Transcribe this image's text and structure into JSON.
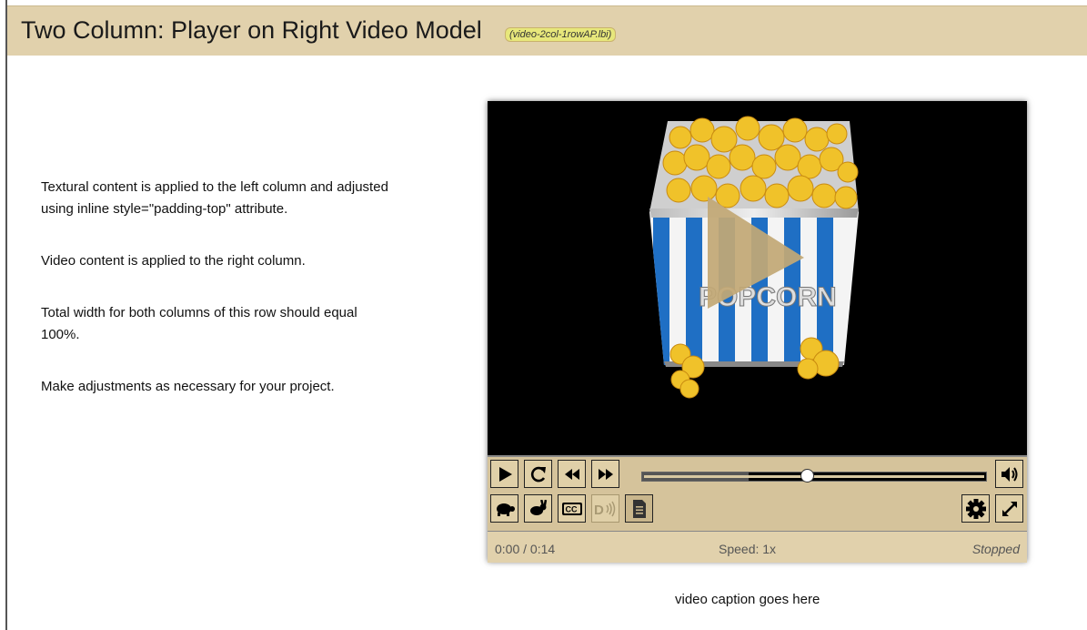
{
  "header": {
    "title": "Two Column: Player on Right Video Model",
    "filename": "(video-2col-1rowAP.lbi)"
  },
  "left_column": {
    "paragraphs": [
      "Textural content is applied to the left column and adjusted using inline style=\"padding-top\" attribute.",
      "Video content is applied to the right column.",
      "Total width for both columns of this row should equal 100%.",
      "Make adjustments as necessary for your project."
    ]
  },
  "player": {
    "poster_text": "POPCORN",
    "progress_fraction": 0.48,
    "buffered_fraction": 0.31,
    "time": "0:00 / 0:14",
    "speed": "Speed: 1x",
    "state": "Stopped",
    "buttons": {
      "row1": [
        "play-icon",
        "restart-icon",
        "rewind-icon",
        "fast-forward-icon"
      ],
      "row2": [
        "slower-turtle-icon",
        "faster-rabbit-icon",
        "captions-cc-icon",
        "audio-description-icon",
        "transcript-icon"
      ],
      "right": [
        "volume-icon",
        "settings-gear-icon",
        "fullscreen-icon"
      ]
    },
    "labels": {
      "cc": "CC",
      "description": "D"
    }
  },
  "caption": "video caption goes here",
  "colors": {
    "header_bg": "#e1d1ac",
    "controls_bg": "#d5c39b",
    "play_overlay": "#c2a875",
    "stripe_blue": "#1f6fc4"
  }
}
